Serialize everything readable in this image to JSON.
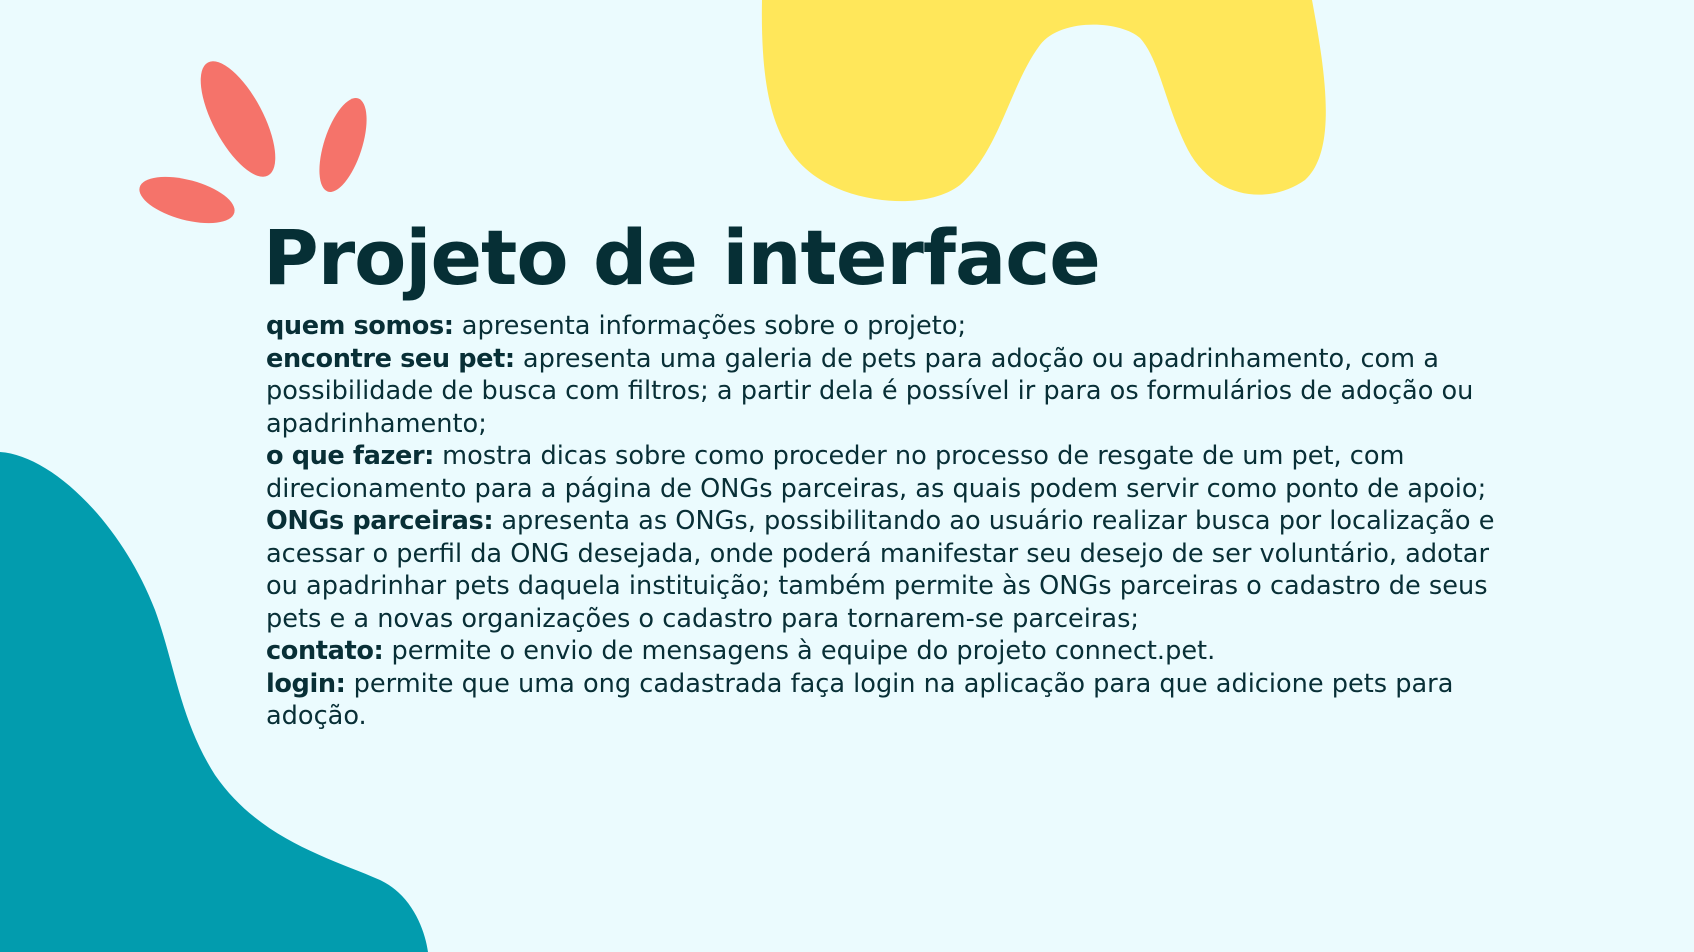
{
  "slide": {
    "title": "Projeto de interface",
    "items": [
      {
        "term": "quem somos:",
        "desc": "apresenta informações sobre o projeto;"
      },
      {
        "term": "encontre seu pet:",
        "desc": "apresenta uma galeria de pets para adoção ou apadrinhamento, com a possibilidade de busca com filtros; a partir dela é possível ir para os formulários de adoção ou apadrinhamento;"
      },
      {
        "term": "o que fazer:",
        "desc": "mostra dicas sobre como proceder no processo de resgate de um pet, com direcionamento para a página de ONGs parceiras, as quais podem servir como ponto de apoio;"
      },
      {
        "term": "ONGs parceiras:",
        "desc": "apresenta as ONGs, possibilitando ao usuário realizar busca por localização e acessar o perfil da ONG desejada, onde poderá manifestar seu desejo de ser voluntário, adotar ou apadrinhar pets daquela instituição; também permite às ONGs parceiras o cadastro de seus pets e a novas organizações o cadastro para tornarem-se parceiras;"
      },
      {
        "term": "contato:",
        "desc": "permite o envio de mensagens à equipe do projeto connect.pet."
      },
      {
        "term": "login:",
        "desc": "permite que uma ong cadastrada faça login na aplicação para que adicione pets para adoção."
      }
    ]
  },
  "colors": {
    "background": "#ebfbfe",
    "text": "#082f36",
    "yellow_shape": "#ffe75a",
    "teal_shape": "#029cae",
    "coral_petals": "#f5736a"
  }
}
